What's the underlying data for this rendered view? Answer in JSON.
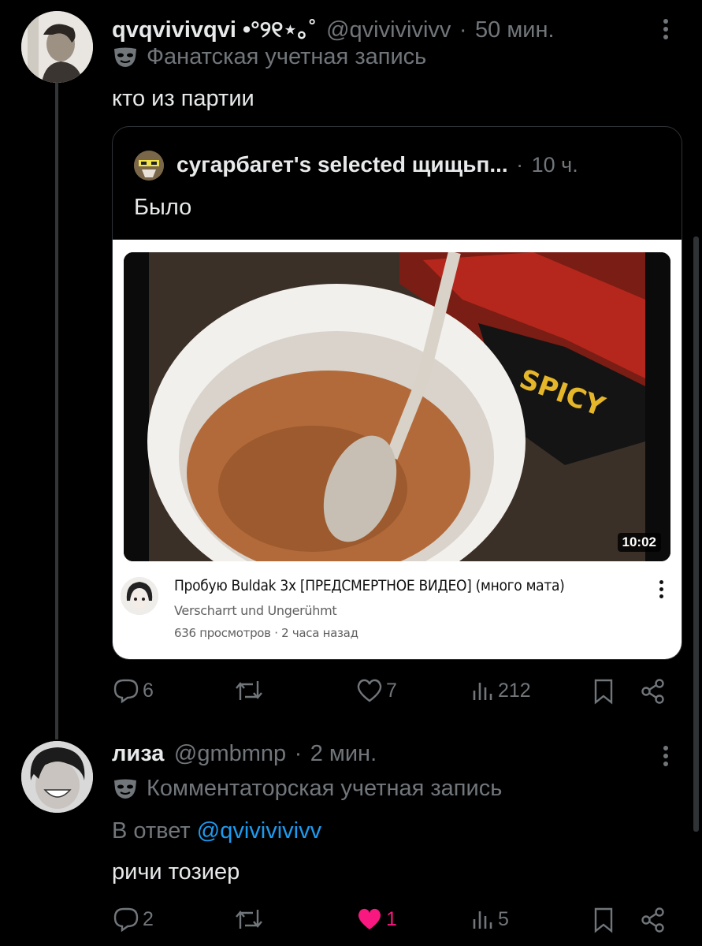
{
  "post": {
    "display_name": "qvqvivivqvi •°୨୧⋆｡˚",
    "handle": "@qvivivivivv",
    "separator": "·",
    "time": "50 мин.",
    "badge": "Фанатская учетная запись",
    "text": "кто из партии",
    "quote": {
      "author": "сугарбагет's selected щищьп...",
      "time": "10 ч.",
      "text": "Было",
      "video": {
        "duration": "10:02",
        "title": "Пробую Buldak 3x [ПРЕДСМЕРТНОЕ ВИДЕО] (много мата)",
        "channel": "Verscharrt und Ungerühmt",
        "stats": "636 просмотров · 2 часа назад"
      }
    },
    "actions": {
      "replies": "6",
      "reposts": "",
      "likes": "7",
      "views": "212"
    }
  },
  "reply": {
    "display_name": "лиза",
    "handle": "@gmbmnp",
    "separator": "·",
    "time": "2 мин.",
    "badge": "Комментаторская учетная запись",
    "reply_prefix": "В ответ",
    "reply_to": "@qvivivivivv",
    "text": "ричи тозиер",
    "actions": {
      "replies": "2",
      "reposts": "",
      "likes": "1",
      "views": "5"
    },
    "like_color": "#f91880"
  },
  "colors": {
    "background": "#000000",
    "text": "#e7e9ea",
    "muted": "#71767b",
    "link": "#1d9bf0",
    "border": "#2f3336"
  }
}
